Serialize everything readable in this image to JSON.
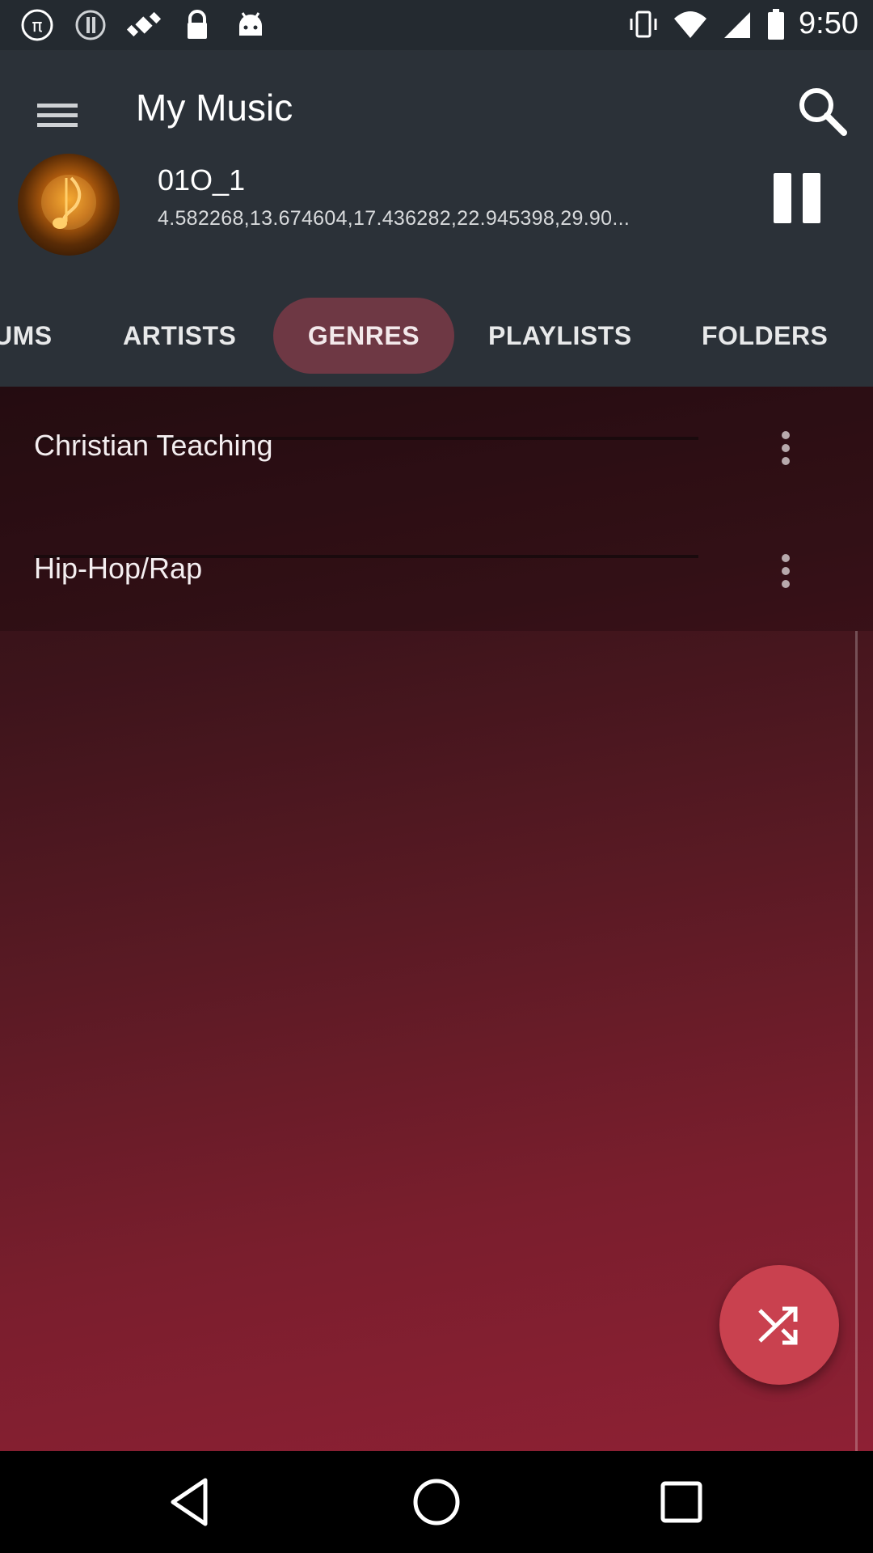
{
  "status_bar": {
    "time": "9:50",
    "icons": [
      "pi-icon",
      "info-icon",
      "satellite-fake-gps-icon",
      "lock-icon",
      "android-icon",
      "vibrate-icon",
      "wifi-icon",
      "signal-icon",
      "battery-icon"
    ]
  },
  "header": {
    "title": "My Music"
  },
  "now_playing": {
    "title": "01O_1",
    "subtitle": "4.582268,13.674604,17.436282,22.945398,29.90..."
  },
  "tabs": [
    {
      "label": "UMS"
    },
    {
      "label": "ARTISTS"
    },
    {
      "label": "GENRES"
    },
    {
      "label": "PLAYLISTS"
    },
    {
      "label": "FOLDERS"
    }
  ],
  "active_tab": "GENRES",
  "genres": [
    {
      "label": "Christian Teaching"
    },
    {
      "label": "Hip-Hop/Rap"
    }
  ],
  "colors": {
    "header_bg": "#2b3138",
    "active_tab_bg": "#6e3844",
    "fab_bg": "#c9414f",
    "content_gradient_start": "#2a0f14",
    "content_gradient_end": "#8e2034"
  }
}
